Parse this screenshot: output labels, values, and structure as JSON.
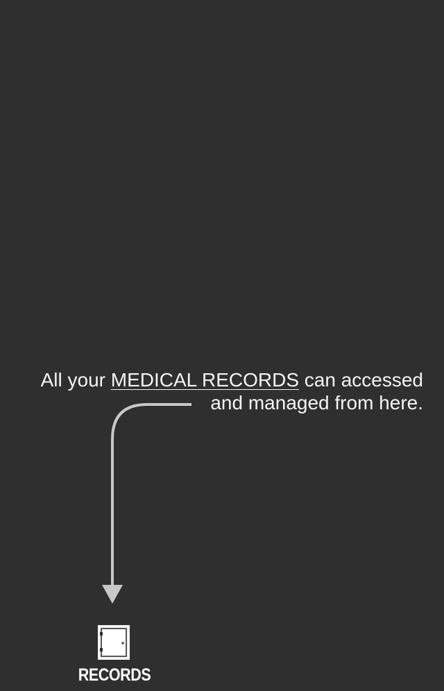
{
  "hint": {
    "line1_prefix": "All your ",
    "line1_emphasis": "MEDICAL RECORDS",
    "line1_suffix": " can accessed",
    "line2": "and managed from here."
  },
  "records": {
    "label": "RECORDS",
    "icon": "safe-icon"
  },
  "colors": {
    "background": "#2f2f2f",
    "arrow": "#c8c8c8",
    "text": "#f4f4f4"
  }
}
